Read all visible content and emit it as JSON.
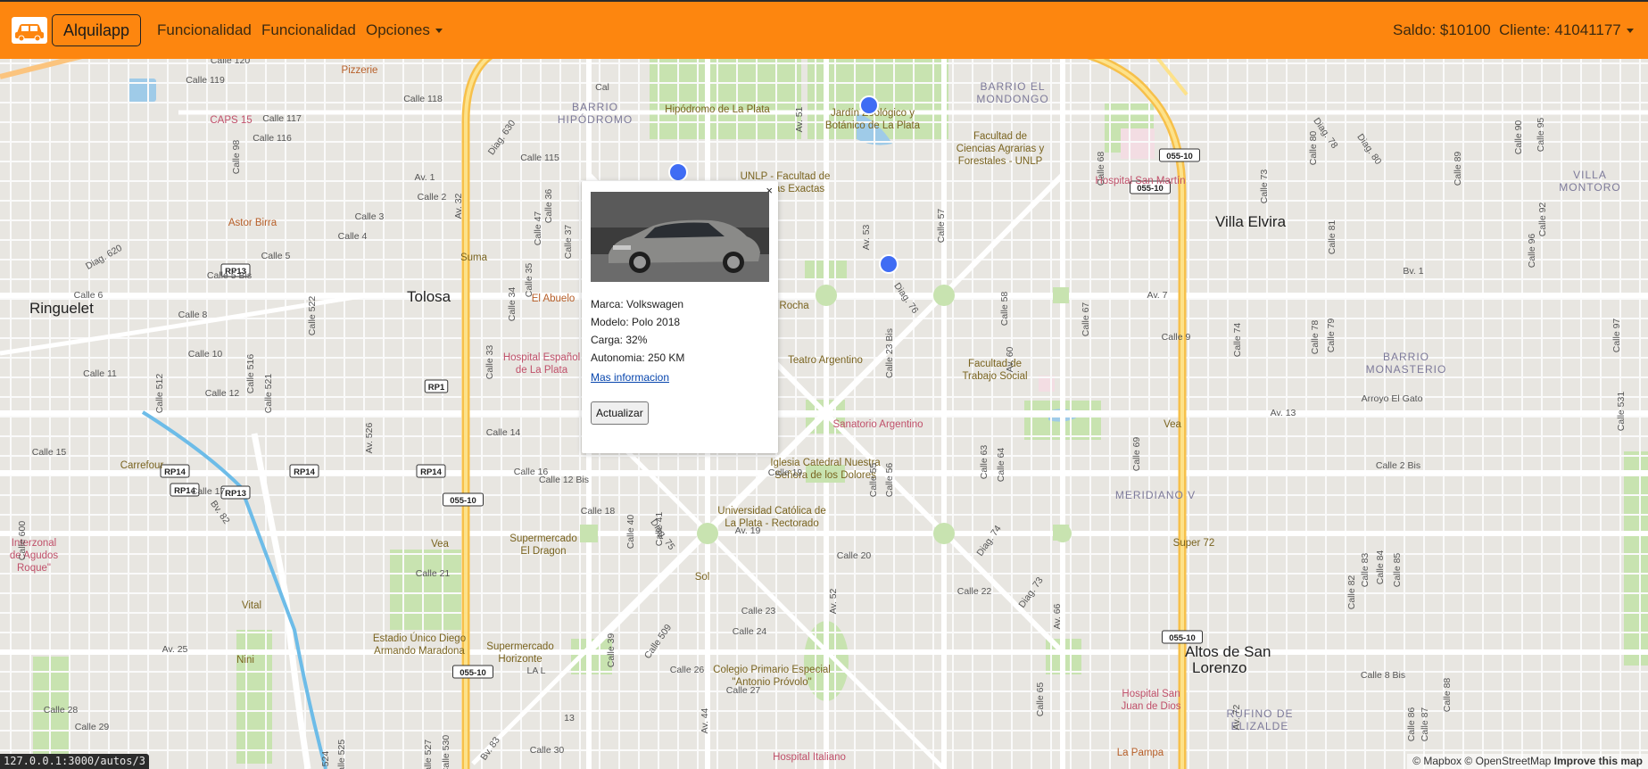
{
  "navbar": {
    "brand": "Alquilapp",
    "links": [
      "Funcionalidad",
      "Funcionalidad"
    ],
    "dropdown": "Opciones",
    "saldo": "Saldo: $10100",
    "cliente": "Cliente: 41041177"
  },
  "popup": {
    "close": "×",
    "marca": "Marca: Volkswagen",
    "modelo": "Modelo: Polo 2018",
    "carga": "Carga: 32%",
    "autonomia": "Autonomia: 250 KM",
    "link": "Mas informacion",
    "button": "Actualizar"
  },
  "status_url": "127.0.0.1:3000/autos/3",
  "attribution": {
    "mapbox": "© Mapbox",
    "osm": "© OpenStreetMap",
    "improve": "Improve this map"
  },
  "map": {
    "places": [
      {
        "text": "Tolosa",
        "big": true
      },
      {
        "text": "Ringuelet",
        "big": true
      },
      {
        "text": "Villa Elvira",
        "big": true
      },
      {
        "text": "Altos de San",
        "big": true
      },
      {
        "text": "Lorenzo",
        "big": true
      },
      {
        "text": "BARRIO EL"
      },
      {
        "text": "MONDONGO"
      },
      {
        "text": "BARRIO"
      },
      {
        "text": "HIPÓDROMO"
      },
      {
        "text": "VILLA"
      },
      {
        "text": "MONTORO"
      },
      {
        "text": "BARRIO"
      },
      {
        "text": "MONASTERIO"
      },
      {
        "text": "MERIDIANO V"
      },
      {
        "text": "RUFINO DE"
      },
      {
        "text": "ELIZALDE"
      }
    ],
    "pois": [
      {
        "text": "Hipódromo de La Plata",
        "c": "#7a6420"
      },
      {
        "text": "Jardín Zoológico y",
        "c": "#7a6420"
      },
      {
        "text": "Botánico de La Plata",
        "c": "#7a6420"
      },
      {
        "text": "Facultad de",
        "c": "#7a6420"
      },
      {
        "text": "Ciencias Agrarias y",
        "c": "#7a6420"
      },
      {
        "text": "Forestales - UNLP",
        "c": "#7a6420"
      },
      {
        "text": "UNLP - Facultad de",
        "c": "#7a6420"
      },
      {
        "text": "Ciencias Exactas",
        "c": "#7a6420"
      },
      {
        "text": "Hospital San Martín",
        "c": "#c0506a"
      },
      {
        "text": "CAPS 15",
        "c": "#c0506a"
      },
      {
        "text": "Pizzerie",
        "c": "#b8602a"
      },
      {
        "text": "Astor Birra",
        "c": "#b8602a"
      },
      {
        "text": "Suma",
        "c": "#7a6420"
      },
      {
        "text": "El Abuelo",
        "c": "#b8602a"
      },
      {
        "text": "Hospital Español",
        "c": "#c0506a"
      },
      {
        "text": "de La Plata",
        "c": "#c0506a"
      },
      {
        "text": "e Dardo Rocha",
        "c": "#7a6420"
      },
      {
        "text": "Teatro Argentino",
        "c": "#7a6420"
      },
      {
        "text": "Facultad de",
        "c": "#7a6420"
      },
      {
        "text": "Trabajo Social",
        "c": "#7a6420"
      },
      {
        "text": "Sanatorio Argentino",
        "c": "#c0506a"
      },
      {
        "text": "Iglesia Catedral Nuestra",
        "c": "#7a6420"
      },
      {
        "text": "Señora de los Dolores",
        "c": "#7a6420"
      },
      {
        "text": "Universidad Católica de",
        "c": "#7a6420"
      },
      {
        "text": "La Plata - Rectorado",
        "c": "#7a6420"
      },
      {
        "text": "Carrefour",
        "c": "#7a6420"
      },
      {
        "text": "Interzonal",
        "c": "#c0506a"
      },
      {
        "text": "de Agudos",
        "c": "#c0506a"
      },
      {
        "text": "Roque\"",
        "c": "#c0506a"
      },
      {
        "text": "Vea",
        "c": "#7a6420"
      },
      {
        "text": "Supermercado",
        "c": "#7a6420"
      },
      {
        "text": "El Dragon",
        "c": "#7a6420"
      },
      {
        "text": "Sol",
        "c": "#7a6420"
      },
      {
        "text": "Vital",
        "c": "#7a6420"
      },
      {
        "text": "Nini",
        "c": "#7a6420"
      },
      {
        "text": "Estadio Único Diego",
        "c": "#7a6420"
      },
      {
        "text": "Armando Maradona",
        "c": "#7a6420"
      },
      {
        "text": "Supermercado",
        "c": "#7a6420"
      },
      {
        "text": "Horizonte",
        "c": "#7a6420"
      },
      {
        "text": "Colegio Primario Especial",
        "c": "#7a6420"
      },
      {
        "text": "\"Antonio Próvolo\"",
        "c": "#7a6420"
      },
      {
        "text": "Super 72",
        "c": "#7a6420"
      },
      {
        "text": "Vea",
        "c": "#7a6420"
      },
      {
        "text": "Hospital San",
        "c": "#c0506a"
      },
      {
        "text": "Juan de Dios",
        "c": "#c0506a"
      },
      {
        "text": "La Pampa",
        "c": "#b8602a"
      },
      {
        "text": "Hospital Italiano",
        "c": "#c0506a"
      }
    ],
    "streets": [
      "Calle 120",
      "Calle 119",
      "Calle 118",
      "Calle 117",
      "Calle 116",
      "Calle 115",
      "Av. 1",
      "Calle 2",
      "Calle 3",
      "Calle 4",
      "Calle 5",
      "Calle 5 Bis",
      "Calle 6",
      "Av. 7",
      "Calle 8",
      "Calle 9",
      "Calle 10",
      "Calle 11",
      "Calle 12",
      "Av. 13",
      "Calle 14",
      "Calle 15",
      "Calle 16",
      "Calle 17",
      "Calle 18",
      "Av. 19",
      "Calle 20",
      "Calle 21",
      "Calle 22",
      "Calle 23",
      "Calle 24",
      "Av. 25",
      "Calle 26",
      "Calle 27",
      "Calle 28",
      "Calle 29",
      "Calle 30",
      "Av. 32",
      "Calle 36",
      "Calle 37",
      "Calle 35",
      "Calle 34",
      "Calle 33",
      "Calle 41",
      "Calle 40",
      "Calle 39",
      "Av. 44",
      "Calle 47",
      "Av. 51",
      "Av. 52",
      "Av. 53",
      "Calle 55",
      "Calle 56",
      "Calle 57",
      "Calle 58",
      "Av. 60",
      "Calle 63",
      "Calle 64",
      "Calle 65",
      "Av. 66",
      "Calle 67",
      "Calle 68",
      "Calle 69",
      "Av. 72",
      "Calle 73",
      "Calle 74",
      "Calle 78",
      "Calle 79",
      "Calle 80",
      "Calle 81",
      "Calle 82",
      "Calle 83",
      "Calle 84",
      "Calle 85",
      "Calle 86",
      "Calle 87",
      "Calle 88",
      "Calle 89",
      "Calle 90",
      "Calle 92",
      "Calle 95",
      "Calle 96",
      "Calle 97",
      "Calle 98",
      "Calle 512",
      "Calle 516",
      "Calle 521",
      "Calle 522",
      "Calle 524",
      "Calle 525",
      "Av. 526",
      "Calle 527",
      "Calle 530",
      "Calle 531",
      "Calle 600",
      "Calle 509",
      "Diag. 73",
      "Diag. 74",
      "Diag. 75",
      "Diag. 76",
      "Diag. 78",
      "Diag. 80",
      "Diag. 620",
      "Diag. 630",
      "Bv. 83",
      "Bv. 82",
      "Bv. 1",
      "Arroyo El Gato",
      "Calle 2 Bis",
      "Calle 8 Bis",
      "Calle 12 Bis",
      "Calle 19",
      "Calle 23 Bis",
      "LA L",
      "13",
      "Cal"
    ],
    "shields": [
      "RP13",
      "RP14",
      "RP1",
      "055-10"
    ]
  }
}
